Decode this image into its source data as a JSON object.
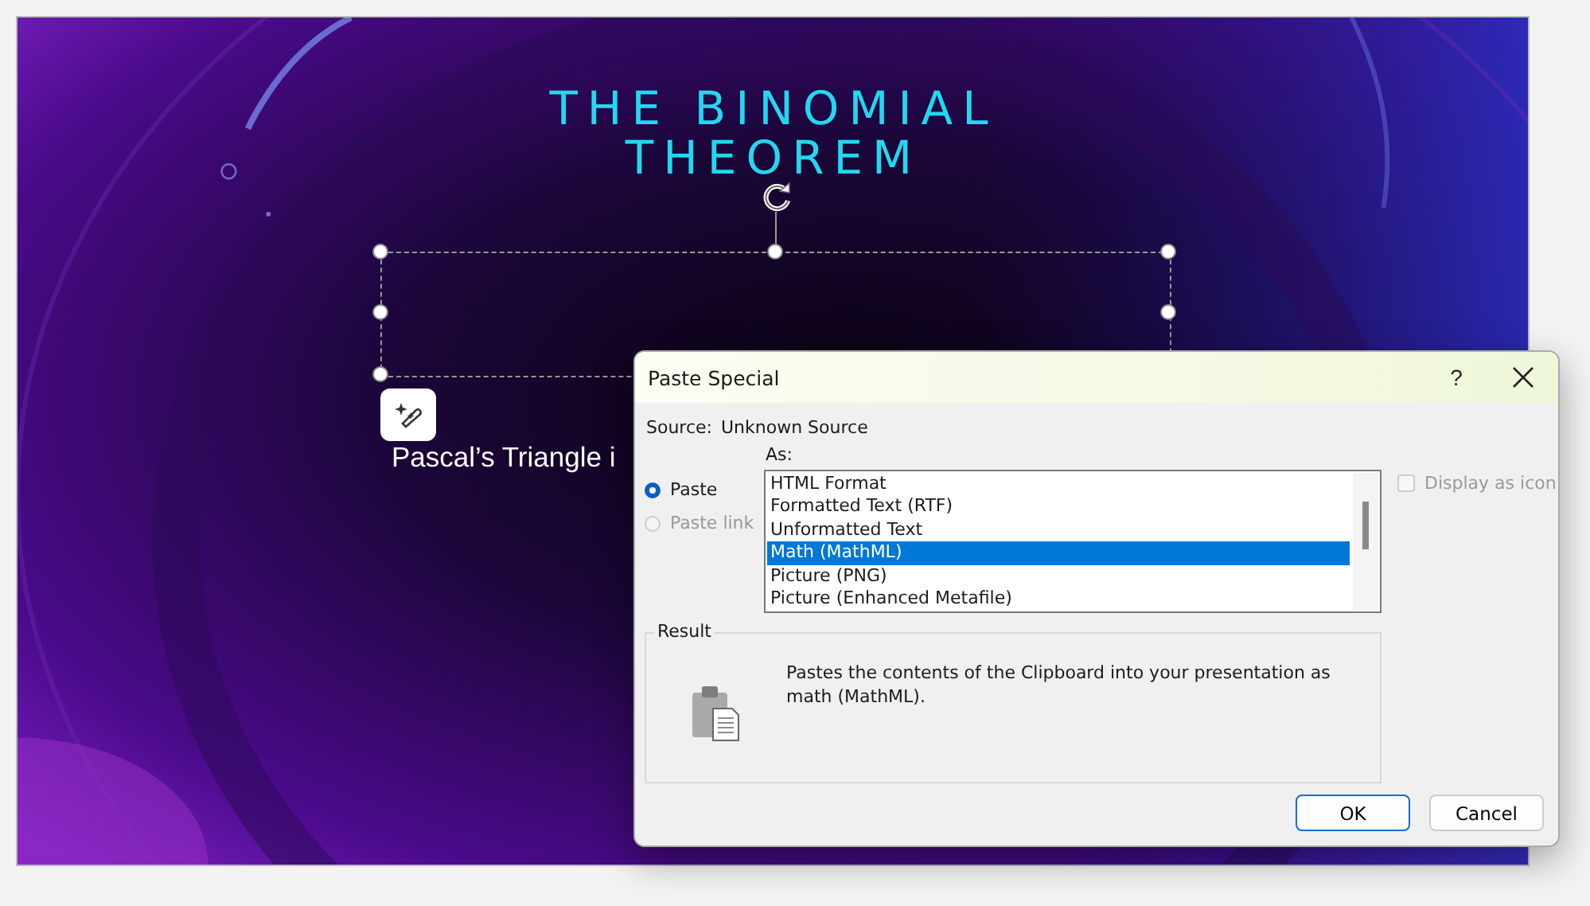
{
  "slide": {
    "title": "THE BINOMIAL THEOREM",
    "body_text": "Pascal’s Triangle i"
  },
  "dialog": {
    "title": "Paste Special",
    "help": "?",
    "source_label": "Source:",
    "source_value": "Unknown Source",
    "as_label": "As:",
    "options": [
      {
        "label": "Paste",
        "selected": true,
        "disabled": false
      },
      {
        "label": "Paste link",
        "selected": false,
        "disabled": true
      }
    ],
    "formats": [
      {
        "label": "HTML Format",
        "selected": false
      },
      {
        "label": "Formatted Text (RTF)",
        "selected": false
      },
      {
        "label": "Unformatted Text",
        "selected": false
      },
      {
        "label": "Math (MathML)",
        "selected": true
      },
      {
        "label": "Picture (PNG)",
        "selected": false
      },
      {
        "label": "Picture (Enhanced Metafile)",
        "selected": false
      }
    ],
    "display_as_icon": {
      "label": "Display as icon",
      "checked": false,
      "disabled": true
    },
    "result": {
      "label": "Result",
      "description": "Pastes the contents of the Clipboard into your presentation as math (MathML)."
    },
    "buttons": [
      {
        "label": "OK",
        "default": true
      },
      {
        "label": "Cancel",
        "default": false
      }
    ]
  }
}
